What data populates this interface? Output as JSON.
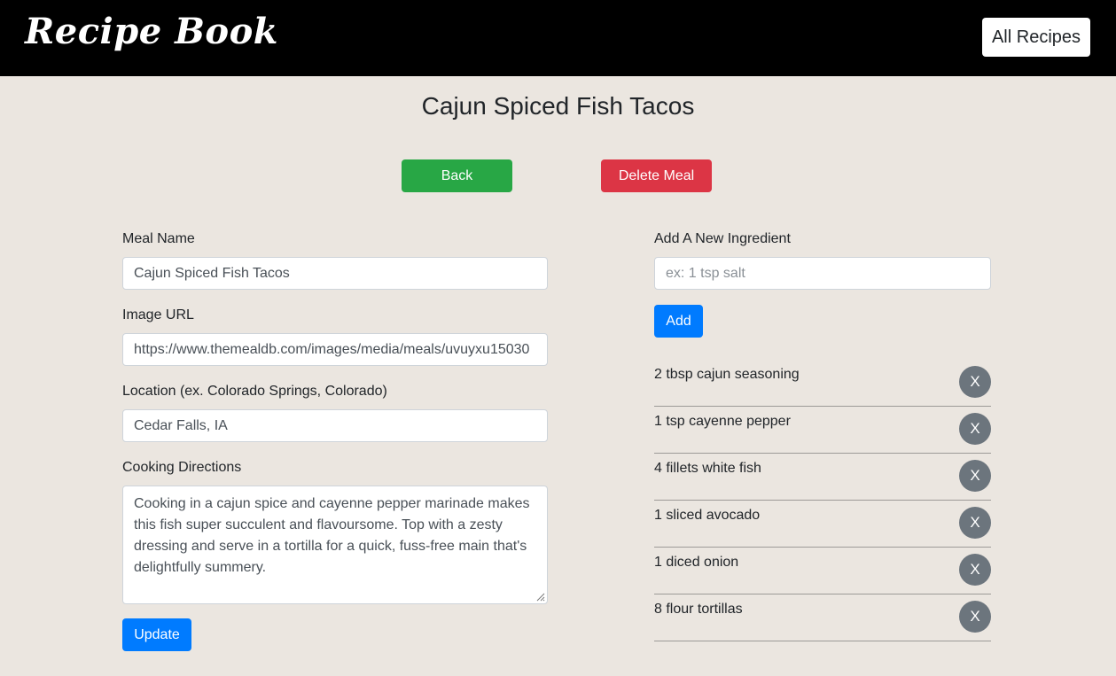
{
  "navbar": {
    "brand": "Recipe Book",
    "all_recipes_label": "All Recipes"
  },
  "page": {
    "title": "Cajun Spiced Fish Tacos"
  },
  "actions": {
    "back_label": "Back",
    "delete_label": "Delete Meal"
  },
  "form": {
    "meal_name": {
      "label": "Meal Name",
      "value": "Cajun Spiced Fish Tacos"
    },
    "image_url": {
      "label": "Image URL",
      "value": "https://www.themealdb.com/images/media/meals/uvuyxu15030"
    },
    "location": {
      "label": "Location (ex. Colorado Springs, Colorado)",
      "value": "Cedar Falls, IA"
    },
    "directions": {
      "label": "Cooking Directions",
      "value": "Cooking in a cajun spice and cayenne pepper marinade makes this fish super succulent and flavoursome. Top with a zesty dressing and serve in a tortilla for a quick, fuss-free main that's delightfully summery."
    },
    "update_label": "Update"
  },
  "ingredients": {
    "label": "Add A New Ingredient",
    "placeholder": "ex: 1 tsp salt",
    "add_label": "Add",
    "remove_label": "X",
    "items": [
      "2 tbsp cajun seasoning",
      "1 tsp cayenne pepper",
      "4 fillets white fish",
      "1 sliced avocado",
      "1 diced onion",
      "8 flour tortillas"
    ]
  },
  "colors": {
    "background": "#ebe6e0",
    "navbar": "#000000",
    "back_button": "#28a745",
    "delete_button": "#dc3545",
    "primary_button": "#007bff",
    "remove_button": "#6c757d"
  }
}
